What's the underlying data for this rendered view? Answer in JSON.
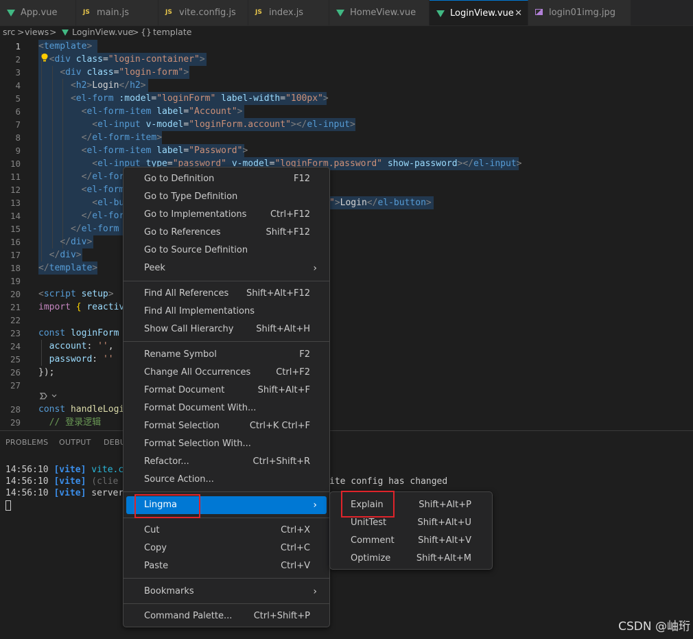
{
  "tabs": [
    {
      "label": "App.vue",
      "icon": "vue-icon"
    },
    {
      "label": "main.js",
      "icon": "js-icon"
    },
    {
      "label": "vite.config.js",
      "icon": "js-icon"
    },
    {
      "label": "index.js",
      "icon": "js-icon"
    },
    {
      "label": "HomeView.vue",
      "icon": "vue-icon"
    },
    {
      "label": "LoginView.vue",
      "icon": "vue-icon",
      "active": true,
      "close": "✕"
    },
    {
      "label": "login01img.jpg",
      "icon": "image-icon"
    }
  ],
  "js_badge": "JS",
  "breadcrumb": {
    "src": "src",
    "views": "views",
    "file": "LoginView.vue",
    "symbol_icon": "{}",
    "symbol": "template",
    "sep": ">"
  },
  "editor": {
    "lines": [
      {
        "n": "1"
      },
      {
        "n": "2"
      },
      {
        "n": "3"
      },
      {
        "n": "4"
      },
      {
        "n": "5"
      },
      {
        "n": "6"
      },
      {
        "n": "7"
      },
      {
        "n": "8"
      },
      {
        "n": "9"
      },
      {
        "n": "10"
      },
      {
        "n": "11"
      },
      {
        "n": "12"
      },
      {
        "n": "13"
      },
      {
        "n": "14"
      },
      {
        "n": "15"
      },
      {
        "n": "16"
      },
      {
        "n": "17"
      },
      {
        "n": "18"
      },
      {
        "n": "19"
      },
      {
        "n": "20"
      },
      {
        "n": "21"
      },
      {
        "n": "22"
      },
      {
        "n": "23"
      },
      {
        "n": "24"
      },
      {
        "n": "25"
      },
      {
        "n": "26"
      },
      {
        "n": "27"
      },
      {
        "n": "28"
      },
      {
        "n": "29"
      }
    ],
    "code": {
      "l1_tag": "template",
      "l2_tag": "div",
      "l2_attr": "class",
      "l2_val": "\"login-container\"",
      "l3_tag": "div",
      "l3_attr": "class",
      "l3_val": "\"login-form\"",
      "l4_text": "Login",
      "l4_tag": "h2",
      "l5_tag": "el-form",
      "l5_attr1": ":model",
      "l5_val1": "\"loginForm\"",
      "l5_attr2": "label-width",
      "l5_val2": "\"100px\"",
      "l6_tag": "el-form-item",
      "l6_attr": "label",
      "l6_val": "\"Account\"",
      "l7_tag": "el-input",
      "l7_attr": "v-model",
      "l7_val": "\"loginForm.account\"",
      "l8_tag": "el-form-item",
      "l9_tag": "el-form-item",
      "l9_attr": "label",
      "l9_val": "\"Password\"",
      "l10_tag": "el-input",
      "l10_attr1": "type",
      "l10_val1": "\"password\"",
      "l10_attr2": "v-model",
      "l10_val2": "\"loginForm.password\"",
      "l10_attr3": "show-password",
      "l11_frag": "el-for",
      "l12_frag": "el-form",
      "l13_frag": "el-bu",
      "l13_tail": "Login",
      "l13_tag": "el-button",
      "l14_frag": "el-for",
      "l15_frag": "el-form",
      "l16_tag": "div",
      "l17_tag": "div",
      "l18_tag": "template",
      "l20_tag": "script",
      "l20_attr": "setup",
      "l21_kw": "import",
      "l21_id": "reactiv",
      "l23_kw": "const",
      "l23_id": "loginForm",
      "l24_key": "account",
      "l24_val": "''",
      "l25_key": "password",
      "l25_val": "''",
      "l26_text": "});",
      "l28_kw": "const",
      "l28_fn": "handleLogi",
      "l29_comment": "// 登录逻辑"
    }
  },
  "panel": {
    "tabs": [
      "PROBLEMS",
      "OUTPUT",
      "DEBU"
    ],
    "terminal": [
      {
        "time": "14:56:10",
        "tag": "[vite]",
        "msg": "vite.c",
        "tail": "ite config has changed"
      },
      {
        "time": "14:56:10",
        "tag": "[vite]",
        "msg": "(clie"
      },
      {
        "time": "14:56:10",
        "tag": "[vite]",
        "msg": "server"
      }
    ]
  },
  "context_menu": {
    "items": [
      {
        "label": "Go to Definition",
        "shortcut": "F12"
      },
      {
        "label": "Go to Type Definition",
        "shortcut": ""
      },
      {
        "label": "Go to Implementations",
        "shortcut": "Ctrl+F12"
      },
      {
        "label": "Go to References",
        "shortcut": "Shift+F12"
      },
      {
        "label": "Go to Source Definition",
        "shortcut": ""
      },
      {
        "label": "Peek",
        "shortcut": "",
        "submenu": true
      },
      {
        "label": "Find All References",
        "shortcut": "Shift+Alt+F12"
      },
      {
        "label": "Find All Implementations",
        "shortcut": ""
      },
      {
        "label": "Show Call Hierarchy",
        "shortcut": "Shift+Alt+H"
      },
      {
        "label": "Rename Symbol",
        "shortcut": "F2"
      },
      {
        "label": "Change All Occurrences",
        "shortcut": "Ctrl+F2"
      },
      {
        "label": "Format Document",
        "shortcut": "Shift+Alt+F"
      },
      {
        "label": "Format Document With...",
        "shortcut": ""
      },
      {
        "label": "Format Selection",
        "shortcut": "Ctrl+K Ctrl+F"
      },
      {
        "label": "Format Selection With...",
        "shortcut": ""
      },
      {
        "label": "Refactor...",
        "shortcut": "Ctrl+Shift+R"
      },
      {
        "label": "Source Action...",
        "shortcut": ""
      },
      {
        "label": "Lingma",
        "shortcut": "",
        "submenu": true,
        "highlighted": true
      },
      {
        "label": "Cut",
        "shortcut": "Ctrl+X"
      },
      {
        "label": "Copy",
        "shortcut": "Ctrl+C"
      },
      {
        "label": "Paste",
        "shortcut": "Ctrl+V"
      },
      {
        "label": "Bookmarks",
        "shortcut": "",
        "submenu": true
      },
      {
        "label": "Command Palette...",
        "shortcut": "Ctrl+Shift+P"
      }
    ],
    "arrow": "›"
  },
  "lingma_submenu": {
    "items": [
      {
        "label": "Explain",
        "shortcut": "Shift+Alt+P"
      },
      {
        "label": "UnitTest",
        "shortcut": "Shift+Alt+U"
      },
      {
        "label": "Comment",
        "shortcut": "Shift+Alt+V"
      },
      {
        "label": "Optimize",
        "shortcut": "Shift+Alt+M"
      }
    ]
  },
  "watermark": "CSDN @岫珩",
  "colors": {
    "accent": "#0078d4",
    "highlight_box": "#e0242a",
    "vue_green": "#41b883",
    "js_yellow": "#e8c64b"
  }
}
